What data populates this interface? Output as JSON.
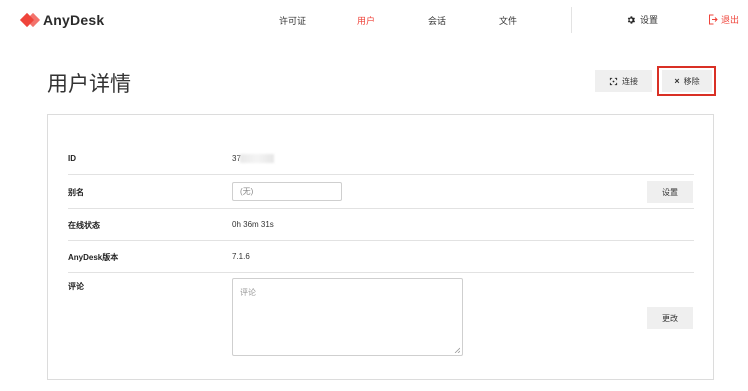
{
  "app": {
    "logo_text": "AnyDesk",
    "brand_color": "#ef443b"
  },
  "nav": {
    "items": [
      {
        "label": "许可证",
        "active": false
      },
      {
        "label": "用户",
        "active": true
      },
      {
        "label": "会话",
        "active": false
      },
      {
        "label": "文件",
        "active": false
      }
    ],
    "settings_label": "设置",
    "logout_label": "退出"
  },
  "page": {
    "title": "用户详情",
    "connect_label": "连接",
    "remove_label": "移除"
  },
  "details": {
    "id_label": "ID",
    "id_value": "37",
    "alias_label": "别名",
    "alias_placeholder": "(无)",
    "alias_button": "设置",
    "online_label": "在线状态",
    "online_value": "0h 36m 31s",
    "version_label": "AnyDesk版本",
    "version_value": "7.1.6",
    "comment_label": "评论",
    "comment_placeholder": "评论",
    "comment_button": "更改"
  }
}
